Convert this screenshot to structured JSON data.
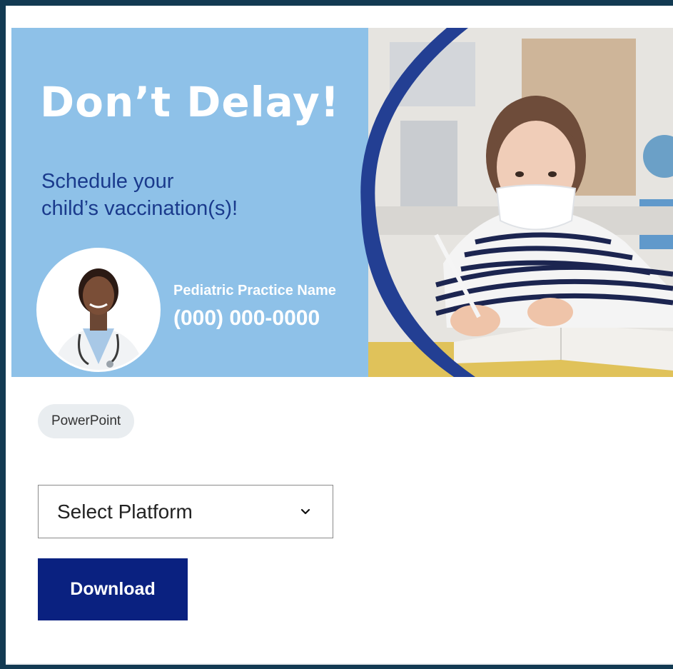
{
  "banner": {
    "headline": "Don’t Delay!",
    "subhead_line1": "Schedule your",
    "subhead_line2": "child’s vaccination(s)!",
    "practice_name": "Pediatric Practice Name",
    "practice_phone": "(000) 000-0000"
  },
  "tag": {
    "label": "PowerPoint"
  },
  "platform_select": {
    "value": "Select Platform",
    "icon": "chevron-down-icon"
  },
  "actions": {
    "download_label": "Download"
  },
  "colors": {
    "frame": "#123a52",
    "banner_bg": "#8ec1e8",
    "banner_arc": "#233f93",
    "subhead_text": "#1a3a8c",
    "chip_bg": "#e9edf0",
    "button_bg": "#0a2180"
  }
}
